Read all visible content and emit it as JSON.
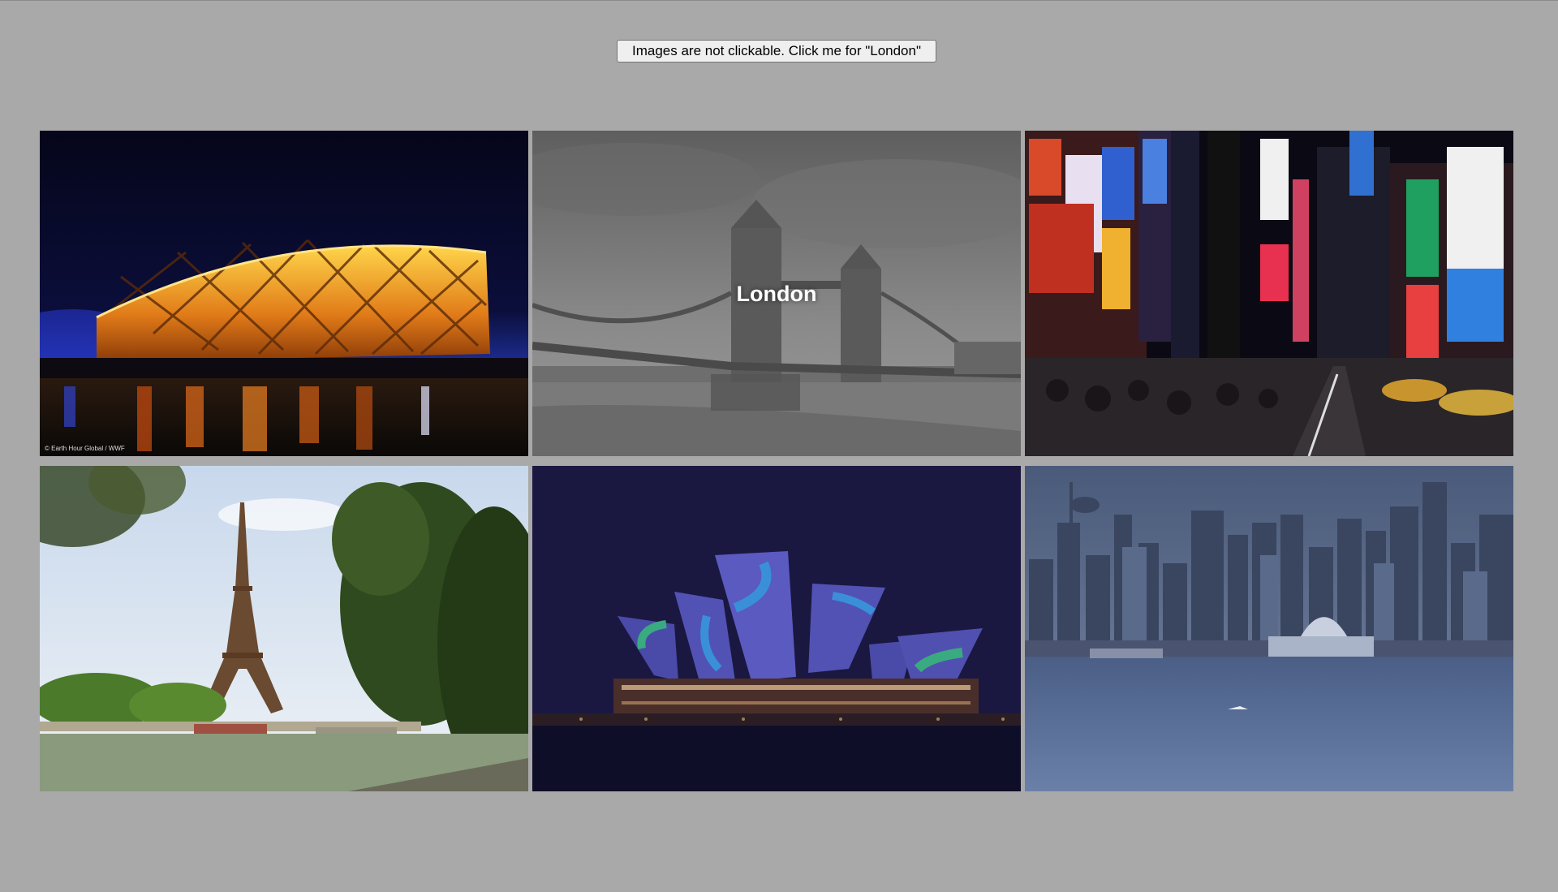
{
  "button": {
    "label": "Images are not clickable. Click me for \"London\""
  },
  "tiles": [
    {
      "scene": "beijing-stadium-night",
      "label": "",
      "credit": "© Earth Hour Global / WWF",
      "selected": false
    },
    {
      "scene": "london-tower-bridge",
      "label": "London",
      "credit": "",
      "selected": true
    },
    {
      "scene": "new-york-times-square",
      "label": "",
      "credit": "",
      "selected": false
    },
    {
      "scene": "paris-eiffel-tower",
      "label": "",
      "credit": "",
      "selected": false
    },
    {
      "scene": "sydney-opera-house-night",
      "label": "",
      "credit": "",
      "selected": false
    },
    {
      "scene": "vancouver-skyline",
      "label": "",
      "credit": "",
      "selected": false
    }
  ],
  "colors": {
    "page_background": "#a9a9a9",
    "selected_overlay": "#7a7a7a"
  }
}
